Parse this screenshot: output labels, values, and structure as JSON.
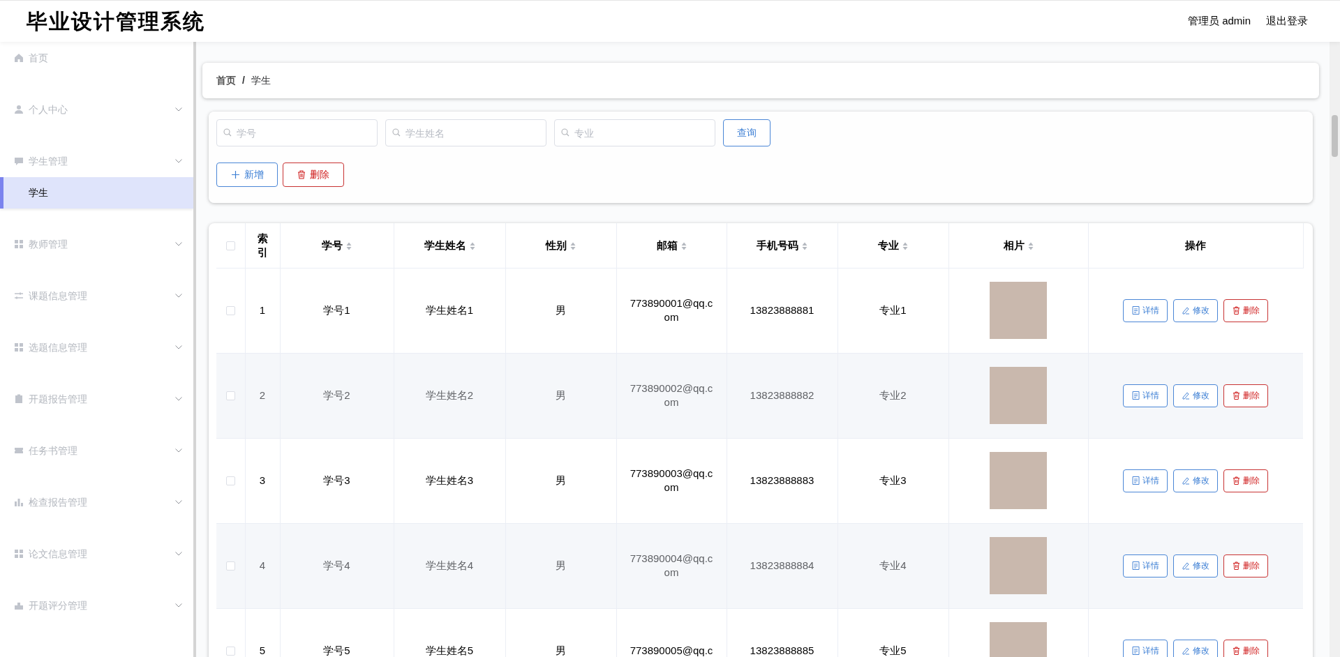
{
  "header": {
    "title": "毕业设计管理系统",
    "user": "管理员 admin",
    "logout": "退出登录"
  },
  "sidebar": {
    "items": [
      {
        "kind": "link",
        "label": "首页"
      },
      {
        "kind": "submenu",
        "label": "个人中心"
      },
      {
        "kind": "submenu",
        "label": "学生管理",
        "children": [
          {
            "label": "学生",
            "selected": true
          }
        ]
      },
      {
        "kind": "submenu",
        "label": "教师管理"
      },
      {
        "kind": "submenu",
        "label": "课题信息管理"
      },
      {
        "kind": "submenu",
        "label": "选题信息管理"
      },
      {
        "kind": "submenu",
        "label": "开题报告管理"
      },
      {
        "kind": "submenu",
        "label": "任务书管理"
      },
      {
        "kind": "submenu",
        "label": "检查报告管理"
      },
      {
        "kind": "submenu",
        "label": "论文信息管理"
      },
      {
        "kind": "submenu",
        "label": "开题评分管理"
      }
    ]
  },
  "breadcrumb": {
    "items": [
      "首页",
      "学生"
    ],
    "separator": "/"
  },
  "search": {
    "fields": [
      {
        "placeholder": "学号"
      },
      {
        "placeholder": "学生姓名"
      },
      {
        "placeholder": "专业"
      }
    ],
    "query_button": "查询"
  },
  "toolbar": {
    "add_button": "新增",
    "delete_button": "删除"
  },
  "table": {
    "all_selected": false,
    "columns": [
      {
        "label": "索引",
        "sortable": false
      },
      {
        "label": "学号",
        "sortable": true
      },
      {
        "label": "学生姓名",
        "sortable": true
      },
      {
        "label": "性别",
        "sortable": true
      },
      {
        "label": "邮箱",
        "sortable": true
      },
      {
        "label": "手机号码",
        "sortable": true
      },
      {
        "label": "专业",
        "sortable": true
      },
      {
        "label": "相片",
        "sortable": true
      },
      {
        "label": "操作",
        "sortable": false
      }
    ],
    "rows": [
      {
        "selected": false,
        "cells": [
          "1",
          "学号1",
          "学生姓名1",
          "男",
          "773890001@qq.com",
          "13823888881",
          "专业1"
        ],
        "actions": [
          "详情",
          "修改",
          "删除"
        ]
      },
      {
        "selected": false,
        "cells": [
          "2",
          "学号2",
          "学生姓名2",
          "男",
          "773890002@qq.com",
          "13823888882",
          "专业2"
        ],
        "actions": [
          "详情",
          "修改",
          "删除"
        ]
      },
      {
        "selected": false,
        "cells": [
          "3",
          "学号3",
          "学生姓名3",
          "男",
          "773890003@qq.com",
          "13823888883",
          "专业3"
        ],
        "actions": [
          "详情",
          "修改",
          "删除"
        ]
      },
      {
        "selected": false,
        "cells": [
          "4",
          "学号4",
          "学生姓名4",
          "男",
          "773890004@qq.com",
          "13823888884",
          "专业4"
        ],
        "actions": [
          "详情",
          "修改",
          "删除"
        ]
      },
      {
        "selected": false,
        "cells": [
          "5",
          "学号5",
          "学生姓名5",
          "男",
          "773890005@qq.c",
          "13823888885",
          "专业5"
        ],
        "actions": [
          "详情",
          "修改",
          "删除"
        ]
      }
    ]
  }
}
